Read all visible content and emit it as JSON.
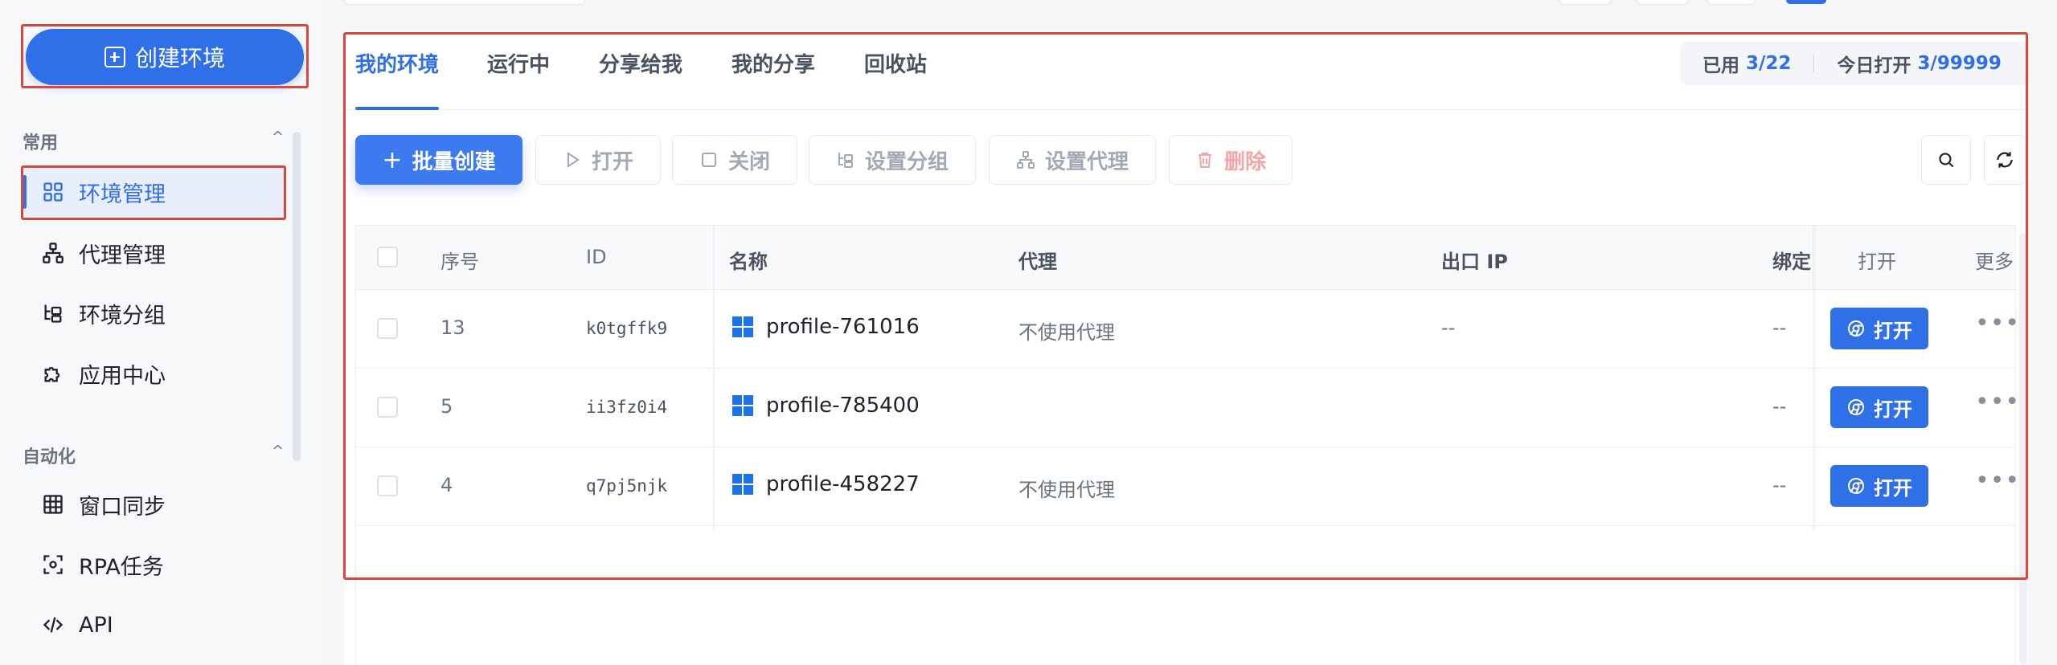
{
  "sidebar": {
    "create_button": "创建环境",
    "sections": [
      {
        "title": "常用",
        "items": [
          {
            "label": "环境管理",
            "icon": "grid-icon",
            "active": true
          },
          {
            "label": "代理管理",
            "icon": "network-icon"
          },
          {
            "label": "环境分组",
            "icon": "tree-icon"
          },
          {
            "label": "应用中心",
            "icon": "puzzle-icon"
          }
        ]
      },
      {
        "title": "自动化",
        "items": [
          {
            "label": "窗口同步",
            "icon": "window-grid-icon"
          },
          {
            "label": "RPA任务",
            "icon": "rpa-icon"
          },
          {
            "label": "API",
            "icon": "code-icon"
          }
        ]
      }
    ],
    "caret": "^"
  },
  "tabs": [
    "我的环境",
    "运行中",
    "分享给我",
    "我的分享",
    "回收站"
  ],
  "quota": {
    "used_label": "已用",
    "used_value": "3/22",
    "today_label": "今日打开",
    "today_value": "3/99999"
  },
  "toolbar": {
    "batch_create": "批量创建",
    "open": "打开",
    "close": "关闭",
    "set_group": "设置分组",
    "set_proxy": "设置代理",
    "delete": "删除"
  },
  "table": {
    "headers": {
      "index": "序号",
      "id": "ID",
      "name": "名称",
      "proxy": "代理",
      "exit_ip": "出口 IP",
      "bind": "绑定",
      "open": "打开",
      "more": "更多"
    },
    "rows": [
      {
        "index": "13",
        "id": "k0tgffk9",
        "name": "profile-761016",
        "proxy": "不使用代理",
        "exit_ip": "--",
        "bind": "--",
        "action": "打开",
        "more": "•••"
      },
      {
        "index": "5",
        "id": "ii3fz0i4",
        "name": "profile-785400",
        "proxy": "",
        "exit_ip": "",
        "bind": "--",
        "action": "打开",
        "more": "•••"
      },
      {
        "index": "4",
        "id": "q7pj5njk",
        "name": "profile-458227",
        "proxy": "不使用代理",
        "exit_ip": "",
        "bind": "--",
        "action": "打开",
        "more": "•••"
      }
    ]
  },
  "colors": {
    "primary": "#2f6fe8",
    "annotation": "#d9483b",
    "danger": "#f5a5a5"
  }
}
